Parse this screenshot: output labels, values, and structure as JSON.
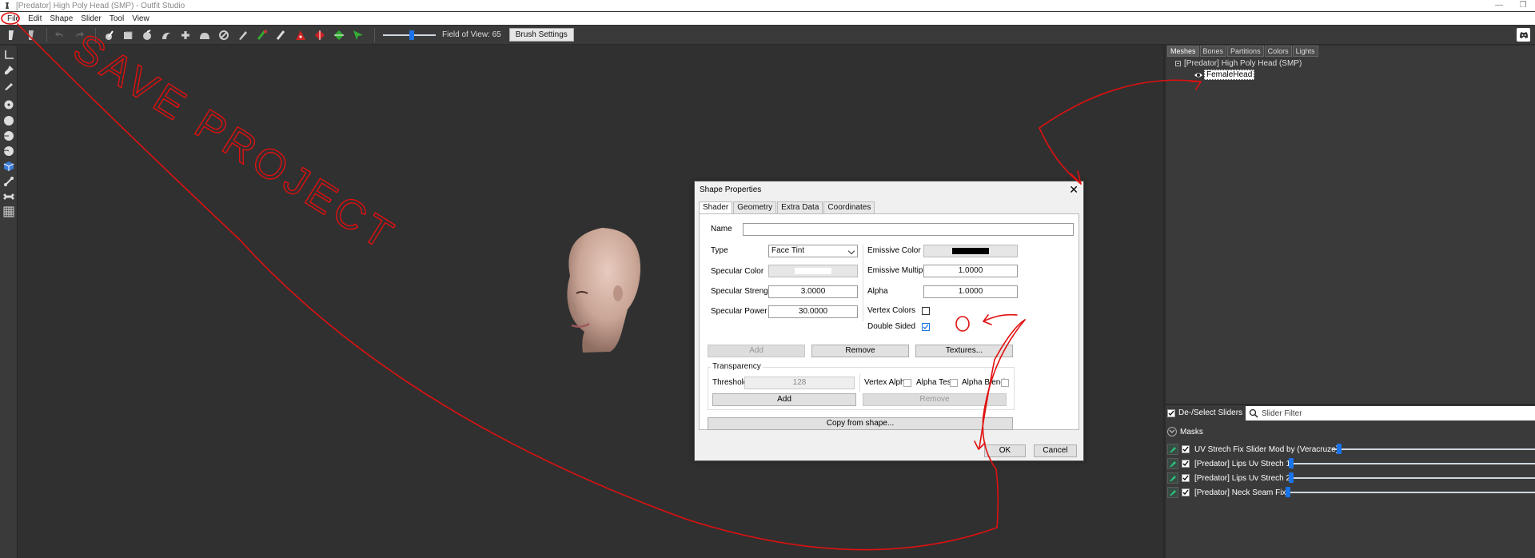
{
  "window": {
    "title": "[Predator] High Poly Head (SMP) - Outfit Studio"
  },
  "menu": {
    "items": [
      "File",
      "Edit",
      "Shape",
      "Slider",
      "Tool",
      "View"
    ]
  },
  "toolbar": {
    "fov_label": "Field of View: 65",
    "fov_value": 65,
    "brush_settings": "Brush Settings"
  },
  "panel": {
    "tabs": [
      "Meshes",
      "Bones",
      "Partitions",
      "Colors",
      "Lights"
    ],
    "active_tab": "Meshes",
    "project": "[Predator] High Poly Head (SMP)",
    "mesh": "FemaleHead",
    "select_sliders": "De-/Select Sliders",
    "filter_placeholder": "Slider Filter",
    "masks": "Masks",
    "sliders": [
      {
        "name": "UV Strech Fix Slider Mod by (Veracruze)",
        "value": 0.22
      },
      {
        "name": "[Predator] Lips Uv Strech 1",
        "value": 0.01
      },
      {
        "name": "[Predator] Lips Uv Strech 2",
        "value": 0.01
      },
      {
        "name": "[Predator] Neck Seam Fix",
        "value": 0.0
      }
    ]
  },
  "dialog": {
    "title": "Shape Properties",
    "tabs": [
      "Shader",
      "Geometry",
      "Extra Data",
      "Coordinates"
    ],
    "active_tab": "Shader",
    "name_label": "Name",
    "name_value": "",
    "type_label": "Type",
    "type_value": "Face Tint",
    "specular_color_label": "Specular Color",
    "specular_color": "#ffffff",
    "specular_strength_label": "Specular Strength",
    "specular_strength": "3.0000",
    "specular_power_label": "Specular Power",
    "specular_power": "30.0000",
    "emissive_color_label": "Emissive Color",
    "emissive_color": "#000000",
    "emissive_multiple_label": "Emissive Multiple",
    "emissive_multiple": "1.0000",
    "alpha_label": "Alpha",
    "alpha": "1.0000",
    "vertex_colors_label": "Vertex Colors",
    "double_sided_label": "Double Sided",
    "btn_add": "Add",
    "btn_remove": "Remove",
    "btn_textures": "Textures...",
    "transparency_label": "Transparency",
    "threshold_label": "Threshold",
    "threshold": "128",
    "vertex_alpha_label": "Vertex Alpha",
    "alpha_test_label": "Alpha Test",
    "alpha_blend_label": "Alpha Blend",
    "btn_add2": "Add",
    "btn_remove2": "Remove",
    "btn_copy": "Copy from shape...",
    "btn_ok": "OK",
    "btn_cancel": "Cancel"
  },
  "annotation": {
    "text": "SAVE PROJECT",
    "color": "#e01010"
  }
}
